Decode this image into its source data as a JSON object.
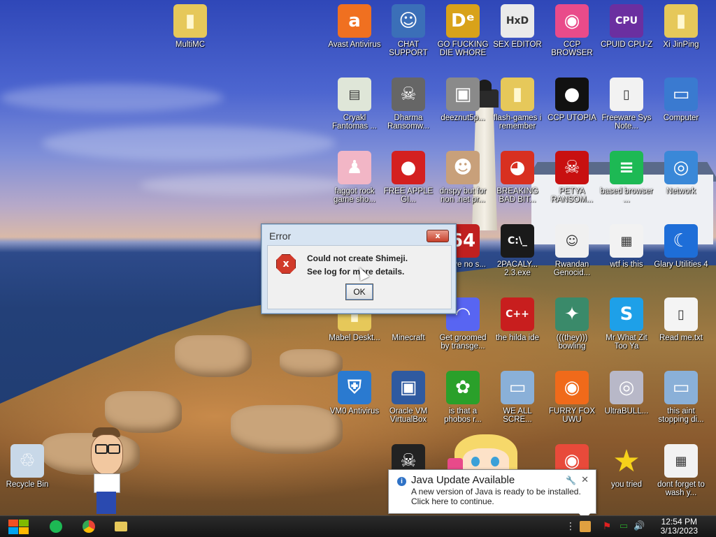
{
  "desktop": {
    "icons": [
      {
        "id": "multimc",
        "label": "MultiMC",
        "glyph": "▮",
        "icon": "folder-icon",
        "color": "#e6c85a"
      },
      {
        "id": "avast",
        "label": "Avast Antivirus",
        "glyph": "a",
        "icon": "avast-icon",
        "color": "#f07020"
      },
      {
        "id": "chat-support",
        "label": "CHAT SUPPORT",
        "glyph": "☺",
        "icon": "doctor-icon",
        "color": "#3b6fb8"
      },
      {
        "id": "go-f",
        "label": "GO FUCKING DIE WHORE",
        "glyph": "Dᵉ",
        "icon": "dexplorer-icon",
        "color": "#d8a21a"
      },
      {
        "id": "sex-editor",
        "label": "SEX EDITOR",
        "glyph": "HxD",
        "icon": "hex-editor-icon",
        "color": "#eaeaea"
      },
      {
        "id": "ccp-browser",
        "label": "CCP BROWSER",
        "glyph": "◉",
        "icon": "browser-icon",
        "color": "#e94b8a"
      },
      {
        "id": "cpuid",
        "label": "CPUID CPU-Z",
        "glyph": "CPU",
        "icon": "cpuz-icon",
        "color": "#6b2fa0"
      },
      {
        "id": "xi",
        "label": "Xi JinPing",
        "glyph": "▮",
        "icon": "user-folder-icon",
        "color": "#e6c85a"
      },
      {
        "id": "cryakl",
        "label": "Cryakl Fantomas ...",
        "glyph": "▤",
        "icon": "window-icon",
        "color": "#dfe6d8"
      },
      {
        "id": "dharma",
        "label": "Dharma Ransomw...",
        "glyph": "☠",
        "icon": "skull-icon",
        "color": "#666"
      },
      {
        "id": "deeznut",
        "label": "deeznut5p...",
        "glyph": "▣",
        "icon": "stack-icon",
        "color": "#8a8a8a"
      },
      {
        "id": "flash",
        "label": "flash-games i remember",
        "glyph": "▮",
        "icon": "folder-icon",
        "color": "#e6c85a"
      },
      {
        "id": "ccp-utopia",
        "label": "CCP UTOPIA",
        "glyph": "●",
        "icon": "orb-icon",
        "color": "#111"
      },
      {
        "id": "freeware",
        "label": "Freeware Sys Note...",
        "glyph": "▯",
        "icon": "document-icon",
        "color": "#f2f2f2"
      },
      {
        "id": "computer",
        "label": "Computer",
        "glyph": "▭",
        "icon": "computer-icon",
        "color": "#3a7ad0"
      },
      {
        "id": "faggot-rock",
        "label": "faggot rock game sho...",
        "glyph": "♟",
        "icon": "pig-icon",
        "color": "#f2b6c6"
      },
      {
        "id": "apple",
        "label": "FREE APPLE GI...",
        "glyph": "●",
        "icon": "apple-icon",
        "color": "#d42020"
      },
      {
        "id": "dnspy",
        "label": "dnspy but for non .net pr...",
        "glyph": "☻",
        "icon": "portrait-icon",
        "color": "#c8a07a"
      },
      {
        "id": "breaking",
        "label": "BREAKING BAD BIT...",
        "glyph": "◕",
        "icon": "angry-bird-icon",
        "color": "#d83020"
      },
      {
        "id": "petya",
        "label": "PETYA RANSOM...",
        "glyph": "☠",
        "icon": "petya-skull-icon",
        "color": "#c81010"
      },
      {
        "id": "based",
        "label": "based browser ...",
        "glyph": "≡",
        "icon": "chat-bubble-icon",
        "color": "#1db954"
      },
      {
        "id": "network",
        "label": "Network",
        "glyph": "◎",
        "icon": "network-icon",
        "color": "#3a88d8"
      },
      {
        "id": "above",
        "label": "above no s...",
        "glyph": "64",
        "icon": "n64-icon",
        "color": "#c02020"
      },
      {
        "id": "2pacaly",
        "label": "2PACALY... 2.3.exe",
        "glyph": "C:\\_",
        "icon": "console-icon",
        "color": "#1a1a1a"
      },
      {
        "id": "rwandan",
        "label": "Rwandan Genocid...",
        "glyph": "☺",
        "icon": "face-icon",
        "color": "#f0f0f0"
      },
      {
        "id": "wtf",
        "label": "wtf is this",
        "glyph": "▦",
        "icon": "calendar-doc-icon",
        "color": "#f2f2f2"
      },
      {
        "id": "glary",
        "label": "Glary Utilities 4",
        "glyph": "☾",
        "icon": "glary-icon",
        "color": "#1e6ed8"
      },
      {
        "id": "mabel",
        "label": "Mabel Deskt...",
        "glyph": "▮",
        "icon": "folder-icon",
        "color": "#e6c85a"
      },
      {
        "id": "minecraft",
        "label": "Minecraft",
        "glyph": "",
        "icon": "minecraft-icon",
        "color": "transparent"
      },
      {
        "id": "groomed",
        "label": "Get groomed by transge...",
        "glyph": "◠",
        "icon": "discord-icon",
        "color": "#5865f2"
      },
      {
        "id": "hilda",
        "label": "the hilda ide",
        "glyph": "C++",
        "icon": "devcpp-icon",
        "color": "#c81e1e"
      },
      {
        "id": "bowling",
        "label": "(((they))) bowling",
        "glyph": "✦",
        "icon": "bowling-icon",
        "color": "#3a8a6a"
      },
      {
        "id": "mrwhat",
        "label": "Mr What Zit Too Ya",
        "glyph": "S",
        "icon": "skype-icon",
        "color": "#1ea0e8"
      },
      {
        "id": "readme",
        "label": "Read me.txt",
        "glyph": "▯",
        "icon": "text-file-icon",
        "color": "#f4f4f4"
      },
      {
        "id": "vm0",
        "label": "VM0 Antivirus",
        "glyph": "⛨",
        "icon": "shield-icon",
        "color": "#2a7ad0"
      },
      {
        "id": "oraclevm",
        "label": "Oracle VM VirtualBox",
        "glyph": "▣",
        "icon": "virtualbox-icon",
        "color": "#2f5aa0"
      },
      {
        "id": "phobos",
        "label": "is that a phobos r...",
        "glyph": "✿",
        "icon": "icq-icon",
        "color": "#2aa02a"
      },
      {
        "id": "weall",
        "label": "WE ALL SCRE...",
        "glyph": "▭",
        "icon": "pc-icon",
        "color": "#8ab0d8"
      },
      {
        "id": "furry",
        "label": "FURRY FOX UWU",
        "glyph": "◉",
        "icon": "firefox-icon",
        "color": "#f06a1a"
      },
      {
        "id": "ultrabull",
        "label": "UltraBULL...",
        "glyph": "◎",
        "icon": "disc-icon",
        "color": "#b8b8c8"
      },
      {
        "id": "thisaint",
        "label": "this aint stopping di...",
        "glyph": "▭",
        "icon": "network-pc-icon",
        "color": "#8ab0d8"
      },
      {
        "id": "skull2",
        "label": "",
        "glyph": "☠",
        "icon": "skull-box-icon",
        "color": "#222"
      },
      {
        "id": "chrome",
        "label": "",
        "glyph": "◉",
        "icon": "chrome-icon",
        "color": "#e84a3a"
      },
      {
        "id": "youtried",
        "label": "you tried",
        "glyph": "★",
        "icon": "star-icon",
        "color": "transparent"
      },
      {
        "id": "dontforget",
        "label": "dont forget to wash y...",
        "glyph": "▦",
        "icon": "calendar-doc-icon",
        "color": "#f2f2f2"
      },
      {
        "id": "recycle",
        "label": "Recycle Bin",
        "glyph": "♲",
        "icon": "recycle-bin-icon",
        "color": "#c8d8e8"
      }
    ]
  },
  "error_dialog": {
    "title": "Error",
    "close_label": "x",
    "line1": "Could not create Shimeji.",
    "line2": "See log for more details.",
    "ok_label": "OK"
  },
  "java_notification": {
    "title": "Java Update Available",
    "line1": "A new version of Java is ready to be installed.",
    "line2": "Click here to continue."
  },
  "taskbar": {
    "time": "12:54 PM",
    "date": "3/13/2023",
    "apps": [
      {
        "id": "spotify",
        "icon": "spotify-icon",
        "color": "#1db954"
      },
      {
        "id": "chrome",
        "icon": "chrome-icon",
        "color": "#e84a3a"
      },
      {
        "id": "explorer",
        "icon": "folder-icon",
        "color": "#e6c85a"
      }
    ]
  }
}
